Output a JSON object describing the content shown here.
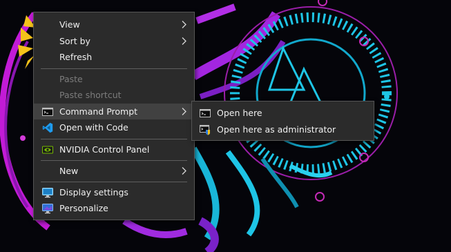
{
  "desktop_menu": {
    "items": [
      {
        "label": "View"
      },
      {
        "label": "Sort by"
      },
      {
        "label": "Refresh"
      },
      {
        "label": "Paste"
      },
      {
        "label": "Paste shortcut"
      },
      {
        "label": "Command Prompt"
      },
      {
        "label": "Open with Code"
      },
      {
        "label": "NVIDIA Control Panel"
      },
      {
        "label": "New"
      },
      {
        "label": "Display settings"
      },
      {
        "label": "Personalize"
      }
    ]
  },
  "command_prompt_submenu": {
    "items": [
      {
        "label": "Open here"
      },
      {
        "label": "Open here as administrator"
      }
    ]
  },
  "icons": {
    "command_prompt": "cmd-icon",
    "vscode": "vscode-icon",
    "nvidia": "nvidia-icon",
    "display": "display-icon",
    "personalize": "personalize-icon"
  },
  "colors": {
    "menu_bg": "#2b2b2b",
    "hover_bg": "#414141",
    "text": "#f0f0f0",
    "disabled_text": "#7c7c7c",
    "vscode_blue": "#1f9cf0",
    "nvidia_green": "#76b900"
  }
}
